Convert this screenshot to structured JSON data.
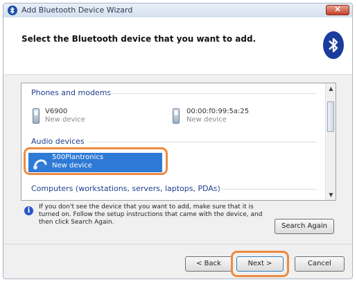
{
  "window": {
    "title": "Add Bluetooth Device Wizard",
    "close_label": "×"
  },
  "header": {
    "heading": "Select the Bluetooth device that you want to add."
  },
  "list": {
    "groups": [
      {
        "label": "Phones and modems"
      },
      {
        "label": "Audio devices"
      },
      {
        "label": "Computers (workstations, servers, laptops, PDAs)"
      }
    ],
    "devices": [
      {
        "name": "V6900",
        "status": "New device"
      },
      {
        "name": "00:00:f0:99:5a:25",
        "status": "New device"
      },
      {
        "name": "500Plantronics",
        "status": "New device"
      }
    ],
    "scroll_up": "▲",
    "scroll_down": "▼"
  },
  "info": {
    "icon": "i",
    "text": "If you don't see the device that you want to add, make sure that it is turned on. Follow the setup instructions that came with the device, and then click Search Again."
  },
  "buttons": {
    "search_again": "Search Again",
    "back": "< Back",
    "next": "Next >",
    "cancel": "Cancel"
  },
  "colors": {
    "accent": "#2f7ad6",
    "highlight_ring": "#ec8a40",
    "bluetooth": "#1a3d9c"
  }
}
